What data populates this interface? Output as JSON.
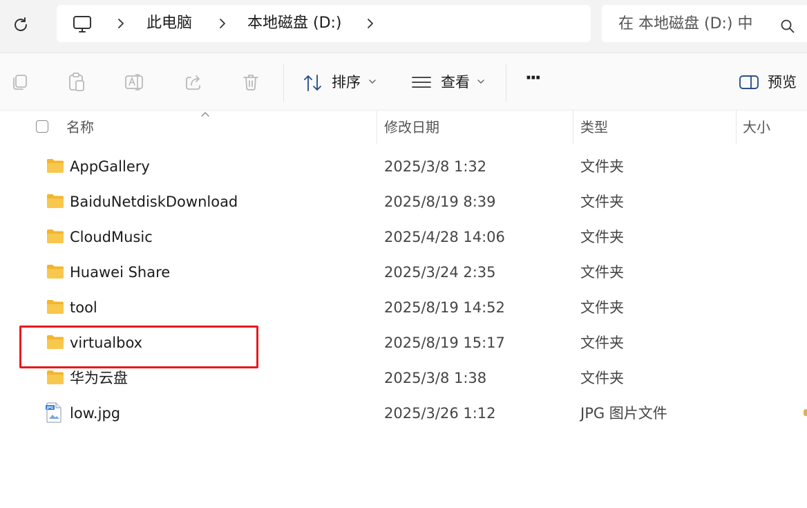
{
  "address": {
    "crumbs": [
      "此电脑",
      "本地磁盘 (D:)"
    ],
    "search_placeholder": "在 本地磁盘 (D:) 中"
  },
  "toolbar": {
    "sort_label": "排序",
    "view_label": "查看",
    "more_label": "···",
    "preview_label": "预览"
  },
  "columns": {
    "name": "名称",
    "modified": "修改日期",
    "type": "类型",
    "size": "大小"
  },
  "files": [
    {
      "name": "AppGallery",
      "modified": "2025/3/8 1:32",
      "type": "文件夹",
      "icon": "folder-icon"
    },
    {
      "name": "BaiduNetdiskDownload",
      "modified": "2025/8/19 8:39",
      "type": "文件夹",
      "icon": "folder-icon"
    },
    {
      "name": "CloudMusic",
      "modified": "2025/4/28 14:06",
      "type": "文件夹",
      "icon": "folder-icon"
    },
    {
      "name": "Huawei Share",
      "modified": "2025/3/24 2:35",
      "type": "文件夹",
      "icon": "folder-icon"
    },
    {
      "name": "tool",
      "modified": "2025/8/19 14:52",
      "type": "文件夹",
      "icon": "folder-icon"
    },
    {
      "name": "virtualbox",
      "modified": "2025/8/19 15:17",
      "type": "文件夹",
      "icon": "folder-icon"
    },
    {
      "name": "华为云盘",
      "modified": "2025/3/8 1:38",
      "type": "文件夹",
      "icon": "folder-icon"
    },
    {
      "name": "low.jpg",
      "modified": "2025/3/26 1:12",
      "type": "JPG 图片文件",
      "icon": "jpg-file-icon"
    }
  ],
  "icons": {
    "file_icon_label": "JPG"
  },
  "colors": {
    "highlight": "#e8191d",
    "folder": "#f8c74d"
  }
}
